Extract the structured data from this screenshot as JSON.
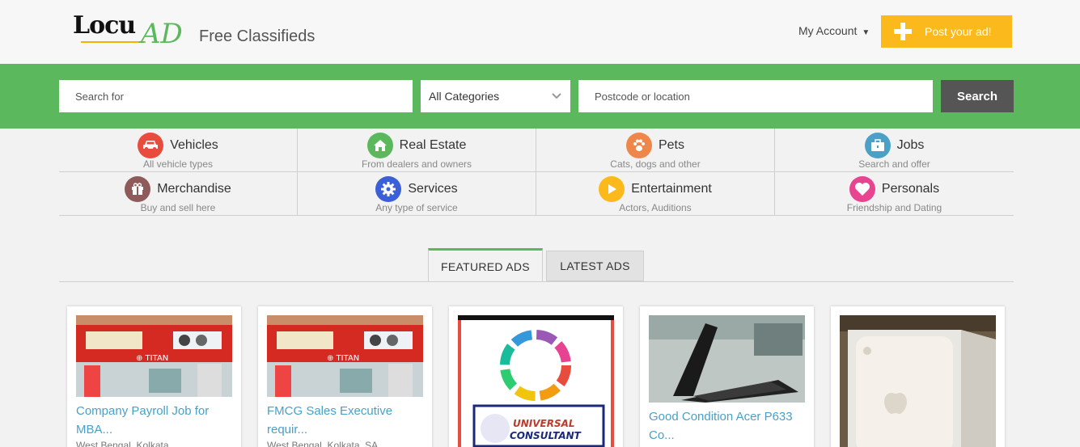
{
  "header": {
    "logo_locu": "Locu",
    "logo_ad": "AD",
    "tagline": "Free Classifieds",
    "account_label": "My Account",
    "post_label": "Post your ad!"
  },
  "search": {
    "query_placeholder": "Search for",
    "category_value": "All Categories",
    "location_placeholder": "Postcode or location",
    "button_label": "Search"
  },
  "categories": [
    {
      "name": "Vehicles",
      "sub": "All vehicle types",
      "icon": "car-icon",
      "color": "#e74c3c"
    },
    {
      "name": "Real Estate",
      "sub": "From dealers and owners",
      "icon": "house-icon",
      "color": "#5cb85c"
    },
    {
      "name": "Pets",
      "sub": "Cats, dogs and other",
      "icon": "paw-icon",
      "color": "#f0874a"
    },
    {
      "name": "Jobs",
      "sub": "Search and offer",
      "icon": "briefcase-icon",
      "color": "#4aa0c7"
    },
    {
      "name": "Merchandise",
      "sub": "Buy and sell here",
      "icon": "gift-icon",
      "color": "#8e5a5a"
    },
    {
      "name": "Services",
      "sub": "Any type of service",
      "icon": "gear-icon",
      "color": "#3b5fd6"
    },
    {
      "name": "Entertainment",
      "sub": "Actors, Auditions",
      "icon": "play-icon",
      "color": "#fbb91b"
    },
    {
      "name": "Personals",
      "sub": "Friendship and Dating",
      "icon": "heart-icon",
      "color": "#e8448f"
    }
  ],
  "tabs": {
    "featured": "FEATURED ADS",
    "latest": "LATEST ADS"
  },
  "ads": [
    {
      "title": "Company Payroll Job for MBA...",
      "location": "West Bengal, Kolkata",
      "image": "storefront-photo"
    },
    {
      "title": "FMCG Sales Executive requir...",
      "location": "West Bengal, Kolkata, SA",
      "image": "storefront-photo"
    },
    {
      "title": "",
      "location": "",
      "image": "universal-consultant-logo"
    },
    {
      "title": "Good Condition Acer P633 Co...",
      "location": "",
      "image": "laptop-photo"
    },
    {
      "title": "",
      "location": "",
      "image": "phone-box-photo"
    }
  ],
  "colors": {
    "brand_green": "#5cb85c",
    "accent_yellow": "#fbb91b",
    "link_blue": "#4aa0c7"
  }
}
